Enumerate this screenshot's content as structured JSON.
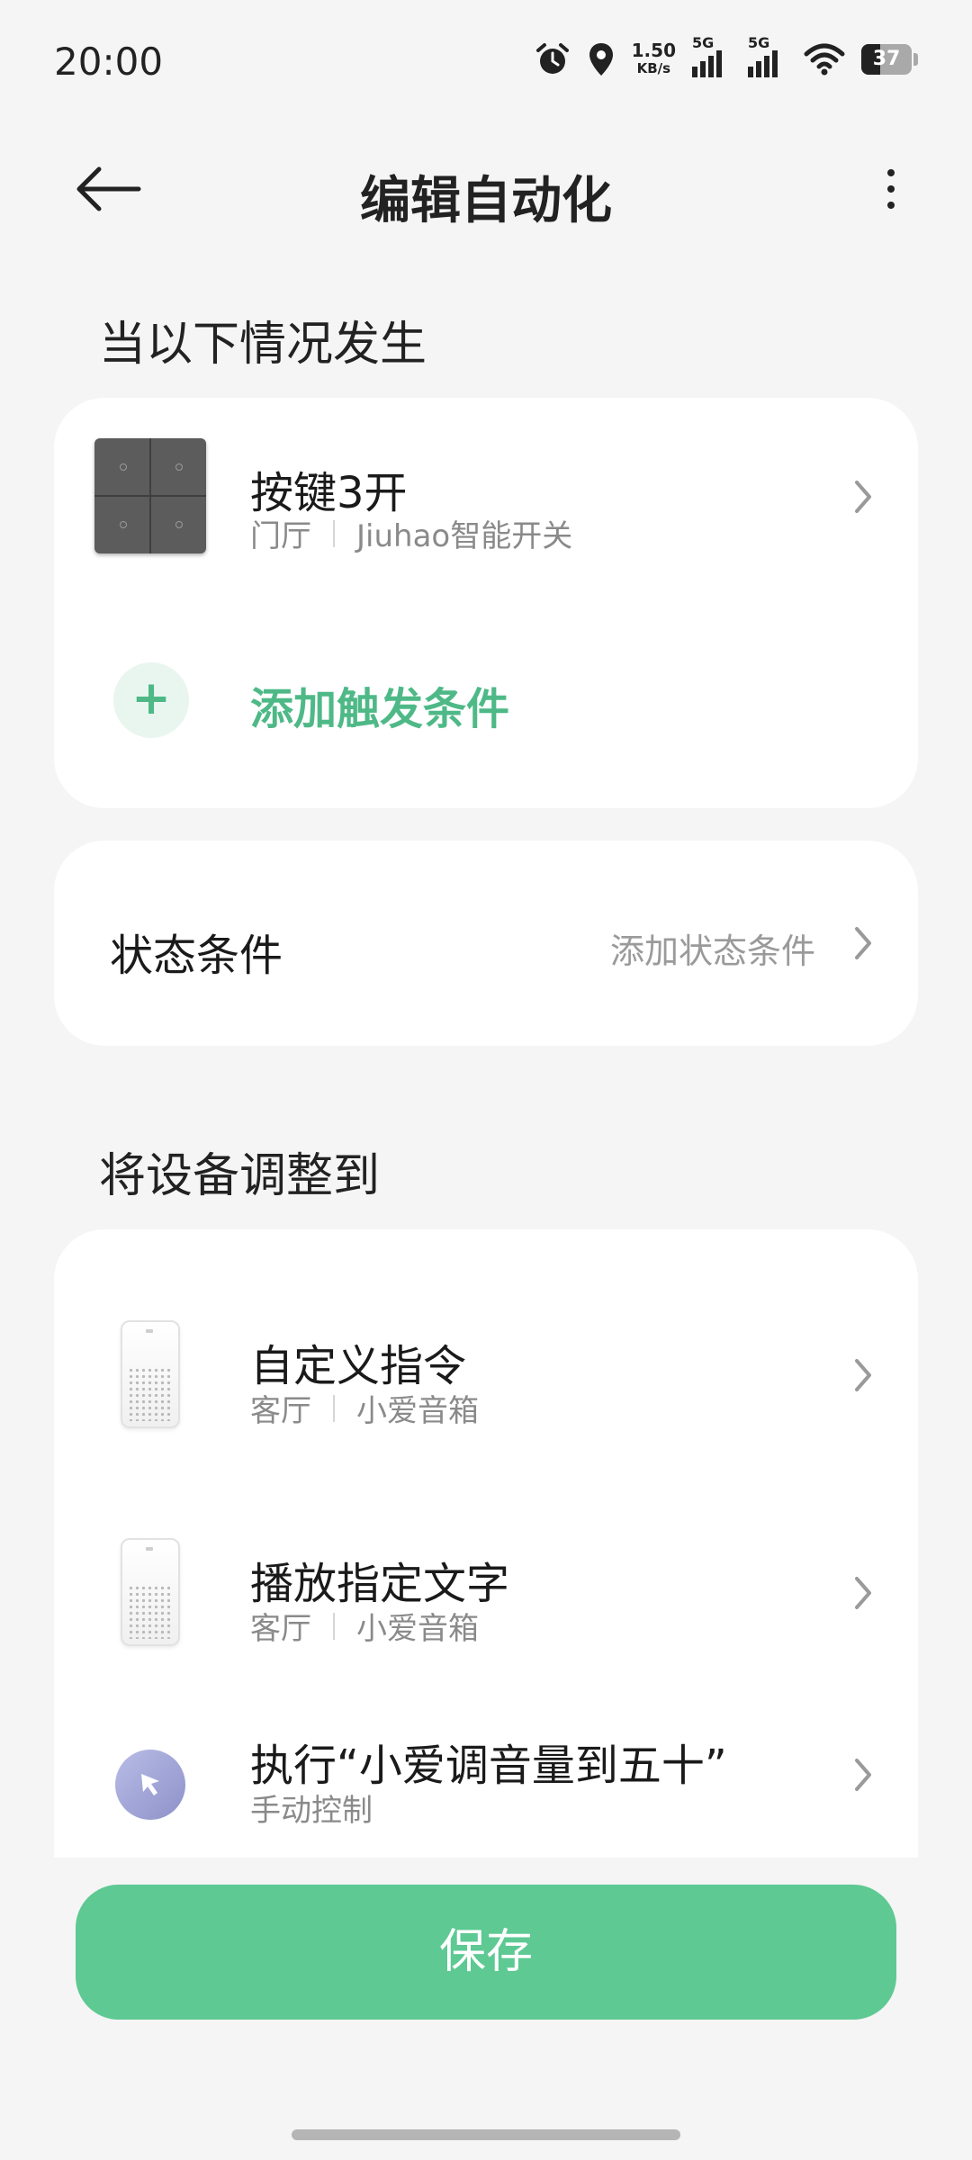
{
  "status_bar": {
    "time": "20:00",
    "net_speed_value": "1.50",
    "net_speed_unit": "KB/s",
    "sim1_gen": "5G",
    "sim2_gen": "5G",
    "battery": "37"
  },
  "header": {
    "title": "编辑自动化"
  },
  "trigger_section": {
    "title": "当以下情况发生",
    "trigger": {
      "title": "按键3开",
      "room": "门厅",
      "device": "Jiuhao智能开关"
    },
    "add_label": "添加触发条件",
    "add_symbol": "+"
  },
  "state_condition": {
    "label": "状态条件",
    "value": "添加状态条件"
  },
  "action_section": {
    "title": "将设备调整到",
    "actions": [
      {
        "title": "自定义指令",
        "room": "客厅",
        "device": "小爱音箱"
      },
      {
        "title": "播放指定文字",
        "room": "客厅",
        "device": "小爱音箱"
      },
      {
        "title": "执行“小爱调音量到五十”",
        "subtitle": "手动控制"
      }
    ]
  },
  "save_label": "保存",
  "colors": {
    "accent": "#4eb987",
    "save_button": "#5ec993",
    "background": "#f5f5f5"
  }
}
